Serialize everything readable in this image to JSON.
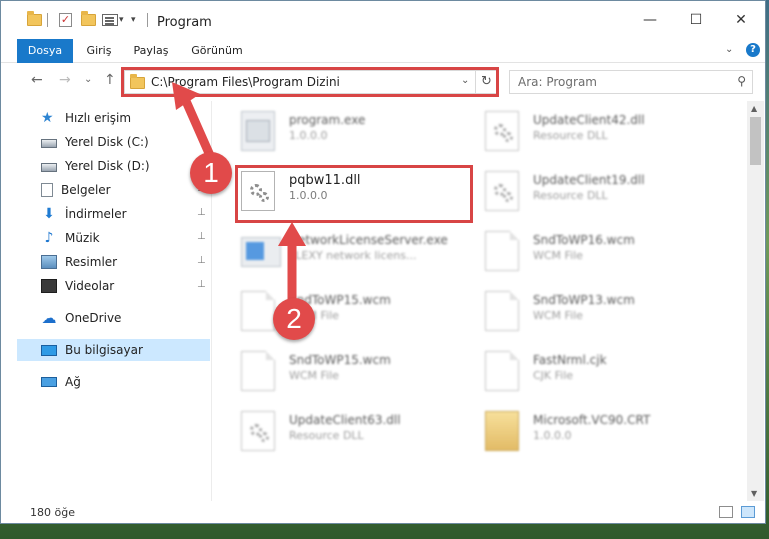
{
  "window": {
    "title": "Program",
    "quick_access_dropdown": "▾",
    "controls": {
      "minimize": "—",
      "maximize": "☐",
      "close": "✕"
    }
  },
  "ribbon": {
    "tabs": [
      "Dosya",
      "Giriş",
      "Paylaş",
      "Görünüm"
    ],
    "expand": "⌄",
    "help": "?"
  },
  "nav": {
    "back": "←",
    "forward": "→",
    "recent": "⌄",
    "up": "↑",
    "address": "C:\\Program Files\\Program Dizini",
    "address_dropdown": "⌄",
    "refresh": "↻",
    "search_placeholder": "Ara: Program",
    "search_icon": "⚲"
  },
  "sidebar": {
    "items": [
      {
        "label": "Hızlı erişim",
        "icon": "star-icon",
        "pinned": false
      },
      {
        "label": "Yerel Disk (C:)",
        "icon": "disk-icon",
        "pinned": false
      },
      {
        "label": "Yerel Disk (D:)",
        "icon": "disk-icon",
        "pinned": false
      },
      {
        "label": "Belgeler",
        "icon": "documents-icon",
        "pinned": true
      },
      {
        "label": "İndirmeler",
        "icon": "download-icon",
        "pinned": true
      },
      {
        "label": "Müzik",
        "icon": "music-icon",
        "pinned": true
      },
      {
        "label": "Resimler",
        "icon": "pictures-icon",
        "pinned": true
      },
      {
        "label": "Videolar",
        "icon": "videos-icon",
        "pinned": true
      },
      {
        "label": "OneDrive",
        "icon": "onedrive-icon",
        "pinned": false
      },
      {
        "label": "Bu bilgisayar",
        "icon": "computer-icon",
        "pinned": false,
        "selected": true
      },
      {
        "label": "Ağ",
        "icon": "network-icon",
        "pinned": false
      }
    ],
    "pin_glyph": "📌"
  },
  "files": {
    "left": [
      {
        "name": "program.exe",
        "meta": "1.0.0.0",
        "icon": "exe"
      },
      {
        "name": "pqbw11.dll",
        "meta": "1.0.0.0",
        "icon": "gear",
        "highlight": true
      },
      {
        "name": "NetworkLicenseServer.exe",
        "meta": "FLEXY network licens...",
        "icon": "server"
      },
      {
        "name": "SndToWP15.wcm",
        "meta": "WCM File",
        "icon": "doc"
      },
      {
        "name": "SndToWP15.wcm",
        "meta": "WCM File",
        "icon": "doc"
      },
      {
        "name": "UpdateClient63.dll",
        "meta": "Resource DLL",
        "icon": "gear"
      }
    ],
    "right": [
      {
        "name": "UpdateClient42.dll",
        "meta": "Resource DLL",
        "icon": "gear"
      },
      {
        "name": "UpdateClient19.dll",
        "meta": "Resource DLL",
        "icon": "gear"
      },
      {
        "name": "SndToWP16.wcm",
        "meta": "WCM File",
        "icon": "doc"
      },
      {
        "name": "SndToWP13.wcm",
        "meta": "WCM File",
        "icon": "doc"
      },
      {
        "name": "FastNrml.cjk",
        "meta": "CJK File",
        "icon": "doc"
      },
      {
        "name": "Microsoft.VC90.CRT",
        "meta": "1.0.0.0",
        "icon": "cab"
      }
    ]
  },
  "status": {
    "count": "180 öğe"
  },
  "annotations": {
    "badge1": "1",
    "badge2": "2",
    "color": "#e14a4a"
  },
  "colors": {
    "accent": "#1979ca",
    "selection": "#cce8ff",
    "annotation_red": "#d84545"
  }
}
